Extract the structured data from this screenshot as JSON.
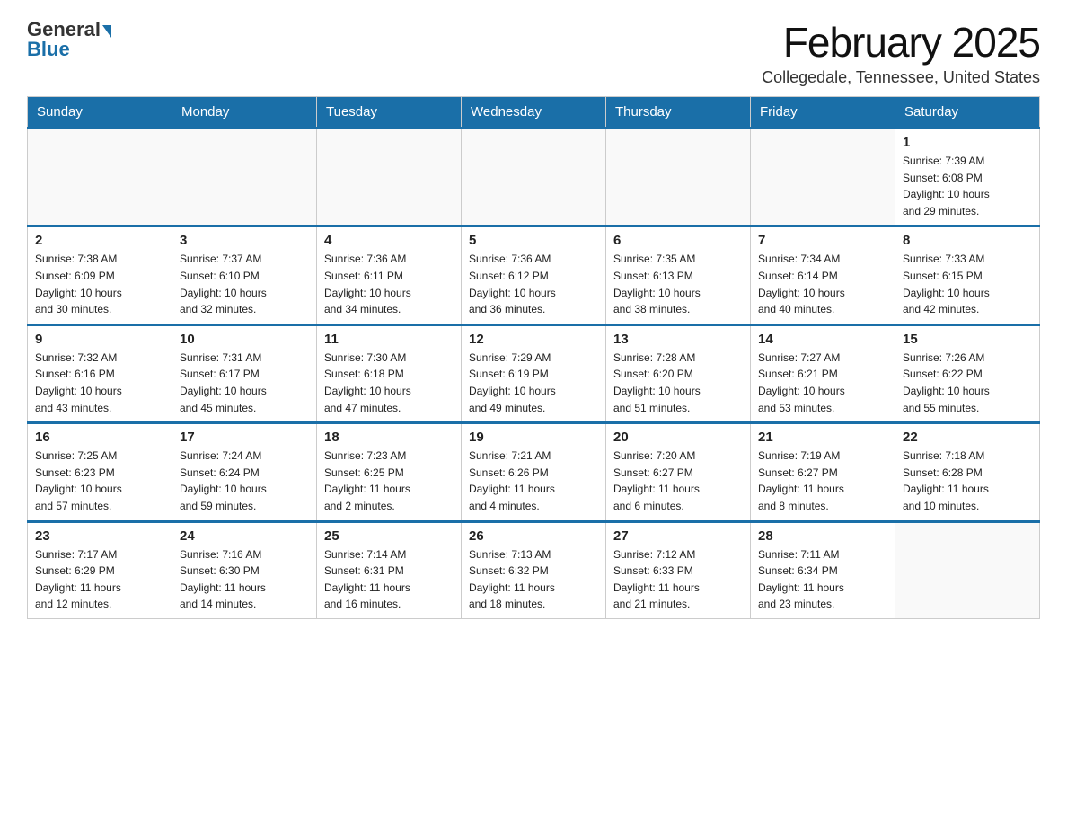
{
  "header": {
    "logo_general": "General",
    "logo_blue": "Blue",
    "month_title": "February 2025",
    "location": "Collegedale, Tennessee, United States"
  },
  "weekdays": [
    "Sunday",
    "Monday",
    "Tuesday",
    "Wednesday",
    "Thursday",
    "Friday",
    "Saturday"
  ],
  "weeks": [
    [
      {
        "day": "",
        "info": ""
      },
      {
        "day": "",
        "info": ""
      },
      {
        "day": "",
        "info": ""
      },
      {
        "day": "",
        "info": ""
      },
      {
        "day": "",
        "info": ""
      },
      {
        "day": "",
        "info": ""
      },
      {
        "day": "1",
        "info": "Sunrise: 7:39 AM\nSunset: 6:08 PM\nDaylight: 10 hours\nand 29 minutes."
      }
    ],
    [
      {
        "day": "2",
        "info": "Sunrise: 7:38 AM\nSunset: 6:09 PM\nDaylight: 10 hours\nand 30 minutes."
      },
      {
        "day": "3",
        "info": "Sunrise: 7:37 AM\nSunset: 6:10 PM\nDaylight: 10 hours\nand 32 minutes."
      },
      {
        "day": "4",
        "info": "Sunrise: 7:36 AM\nSunset: 6:11 PM\nDaylight: 10 hours\nand 34 minutes."
      },
      {
        "day": "5",
        "info": "Sunrise: 7:36 AM\nSunset: 6:12 PM\nDaylight: 10 hours\nand 36 minutes."
      },
      {
        "day": "6",
        "info": "Sunrise: 7:35 AM\nSunset: 6:13 PM\nDaylight: 10 hours\nand 38 minutes."
      },
      {
        "day": "7",
        "info": "Sunrise: 7:34 AM\nSunset: 6:14 PM\nDaylight: 10 hours\nand 40 minutes."
      },
      {
        "day": "8",
        "info": "Sunrise: 7:33 AM\nSunset: 6:15 PM\nDaylight: 10 hours\nand 42 minutes."
      }
    ],
    [
      {
        "day": "9",
        "info": "Sunrise: 7:32 AM\nSunset: 6:16 PM\nDaylight: 10 hours\nand 43 minutes."
      },
      {
        "day": "10",
        "info": "Sunrise: 7:31 AM\nSunset: 6:17 PM\nDaylight: 10 hours\nand 45 minutes."
      },
      {
        "day": "11",
        "info": "Sunrise: 7:30 AM\nSunset: 6:18 PM\nDaylight: 10 hours\nand 47 minutes."
      },
      {
        "day": "12",
        "info": "Sunrise: 7:29 AM\nSunset: 6:19 PM\nDaylight: 10 hours\nand 49 minutes."
      },
      {
        "day": "13",
        "info": "Sunrise: 7:28 AM\nSunset: 6:20 PM\nDaylight: 10 hours\nand 51 minutes."
      },
      {
        "day": "14",
        "info": "Sunrise: 7:27 AM\nSunset: 6:21 PM\nDaylight: 10 hours\nand 53 minutes."
      },
      {
        "day": "15",
        "info": "Sunrise: 7:26 AM\nSunset: 6:22 PM\nDaylight: 10 hours\nand 55 minutes."
      }
    ],
    [
      {
        "day": "16",
        "info": "Sunrise: 7:25 AM\nSunset: 6:23 PM\nDaylight: 10 hours\nand 57 minutes."
      },
      {
        "day": "17",
        "info": "Sunrise: 7:24 AM\nSunset: 6:24 PM\nDaylight: 10 hours\nand 59 minutes."
      },
      {
        "day": "18",
        "info": "Sunrise: 7:23 AM\nSunset: 6:25 PM\nDaylight: 11 hours\nand 2 minutes."
      },
      {
        "day": "19",
        "info": "Sunrise: 7:21 AM\nSunset: 6:26 PM\nDaylight: 11 hours\nand 4 minutes."
      },
      {
        "day": "20",
        "info": "Sunrise: 7:20 AM\nSunset: 6:27 PM\nDaylight: 11 hours\nand 6 minutes."
      },
      {
        "day": "21",
        "info": "Sunrise: 7:19 AM\nSunset: 6:27 PM\nDaylight: 11 hours\nand 8 minutes."
      },
      {
        "day": "22",
        "info": "Sunrise: 7:18 AM\nSunset: 6:28 PM\nDaylight: 11 hours\nand 10 minutes."
      }
    ],
    [
      {
        "day": "23",
        "info": "Sunrise: 7:17 AM\nSunset: 6:29 PM\nDaylight: 11 hours\nand 12 minutes."
      },
      {
        "day": "24",
        "info": "Sunrise: 7:16 AM\nSunset: 6:30 PM\nDaylight: 11 hours\nand 14 minutes."
      },
      {
        "day": "25",
        "info": "Sunrise: 7:14 AM\nSunset: 6:31 PM\nDaylight: 11 hours\nand 16 minutes."
      },
      {
        "day": "26",
        "info": "Sunrise: 7:13 AM\nSunset: 6:32 PM\nDaylight: 11 hours\nand 18 minutes."
      },
      {
        "day": "27",
        "info": "Sunrise: 7:12 AM\nSunset: 6:33 PM\nDaylight: 11 hours\nand 21 minutes."
      },
      {
        "day": "28",
        "info": "Sunrise: 7:11 AM\nSunset: 6:34 PM\nDaylight: 11 hours\nand 23 minutes."
      },
      {
        "day": "",
        "info": ""
      }
    ]
  ]
}
